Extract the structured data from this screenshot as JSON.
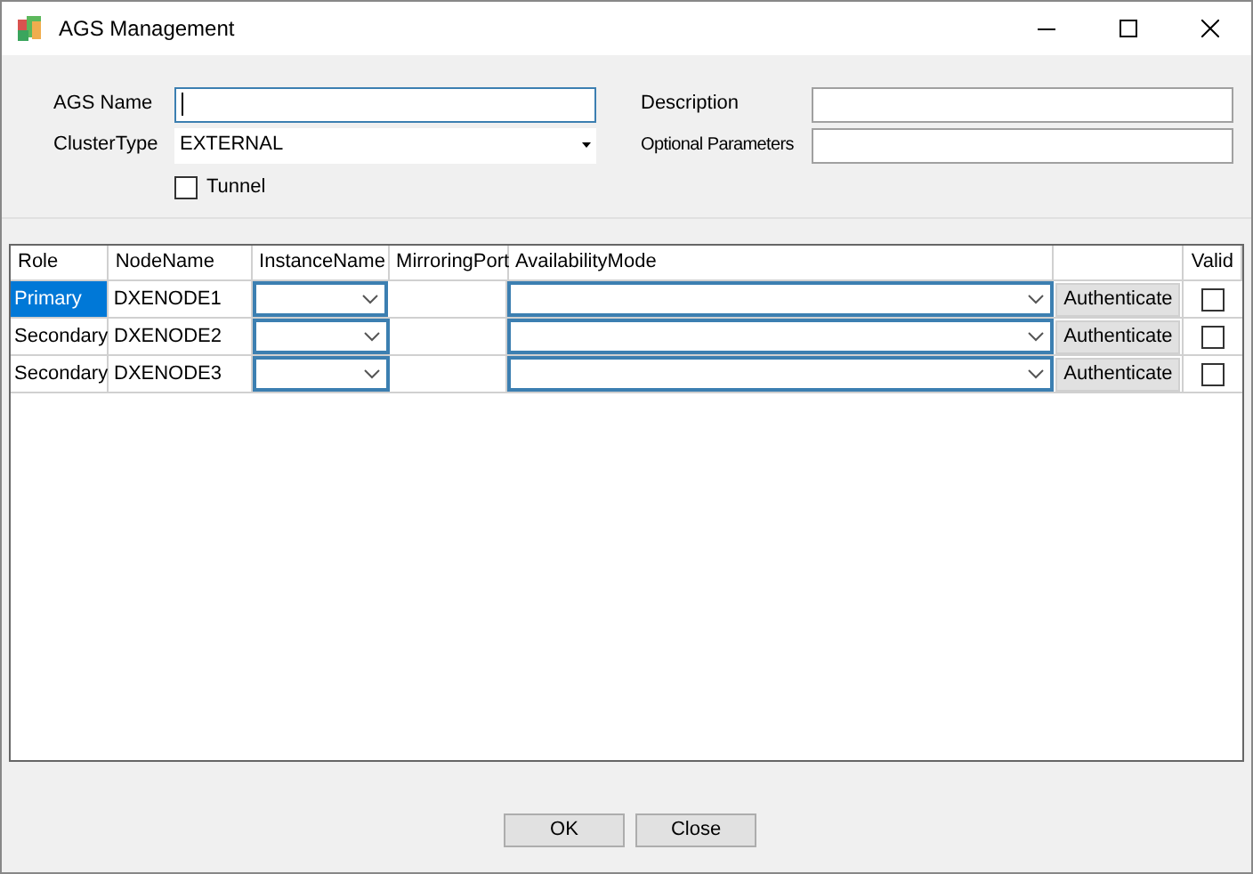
{
  "window": {
    "title": "AGS Management"
  },
  "form": {
    "ags_name": {
      "label": "AGS Name",
      "focused": true
    },
    "cluster_type": {
      "label": "ClusterType",
      "value": "EXTERNAL"
    },
    "tunnel": {
      "label": "Tunnel",
      "checked": false
    },
    "description": {
      "label": "Description",
      "focused": false
    },
    "optional_parameters": {
      "label": "Optional Parameters",
      "focused": false
    }
  },
  "table": {
    "columns": [
      "Role",
      "NodeName",
      "InstanceName",
      "MirroringPort",
      "AvailabilityMode",
      "",
      "Valid"
    ],
    "rows": [
      {
        "role": "Primary",
        "node_name": "DXENODE1",
        "button": "Authenticate",
        "valid": false,
        "selected": true
      },
      {
        "role": "Secondary",
        "node_name": "DXENODE2",
        "button": "Authenticate",
        "valid": false,
        "selected": false
      },
      {
        "role": "Secondary",
        "node_name": "DXENODE3",
        "button": "Authenticate",
        "valid": false,
        "selected": false
      }
    ]
  },
  "buttons": [
    "OK",
    "Close"
  ]
}
